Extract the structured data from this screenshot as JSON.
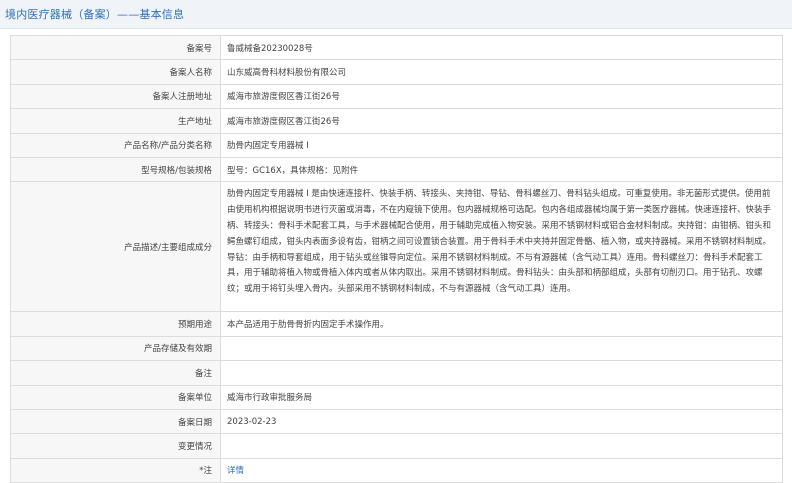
{
  "header": {
    "title": "境内医疗器械（备案）——基本信息"
  },
  "rows": [
    {
      "label": "备案号",
      "value": "鲁威械备20230028号"
    },
    {
      "label": "备案人名称",
      "value": "山东威高骨科材料股份有限公司"
    },
    {
      "label": "备案人注册地址",
      "value": "威海市旅游度假区香江街26号"
    },
    {
      "label": "生产地址",
      "value": "威海市旅游度假区香江街26号"
    },
    {
      "label": "产品名称/产品分类名称",
      "value": "肋骨内固定专用器械 I"
    },
    {
      "label": "型号规格/包装规格",
      "value": "型号：GC16X，具体规格：见附件"
    },
    {
      "label": "产品描述/主要组成成分",
      "value": "肋骨内固定专用器械 I 是由快速连接杆、快装手柄、转接头、夹持钳、导钻、骨科螺丝刀、骨科钻头组成。可重复使用。非无菌形式提供。使用前由使用机构根据说明书进行灭菌或消毒，不在内窥镜下使用。包内器械规格可选配。包内各组成器械均属于第一类医疗器械。快速连接杆、快装手柄、转接头：骨科手术配套工具，与手术器械配合使用，用于辅助完成植入物安装。采用不锈钢材料或铝合金材料制成。夹持钳：由钳柄、钳头和鳄鱼螺钉组成，钳头内表面多设有齿，钳柄之间可设置锁合装置。用于骨科手术中夹持并固定骨骼、植入物，或夹持器械。采用不锈钢材料制成。导钻：由手柄和导套组成，用于钻头或丝锥导向定位。采用不锈钢材料制成。不与有源器械（含气动工具）连用。骨科螺丝刀：骨科手术配套工具，用于辅助将植入物或骨植入体内或者从体内取出。采用不锈钢材料制成。骨科钻头：由头部和柄部组成，头部有切削刃口。用于钻孔、攻螺纹；或用于将钉头埋入骨内。头部采用不锈钢材料制成，不与有源器械（含气动工具）连用。"
    },
    {
      "label": "预期用途",
      "value": "本产品适用于肋骨骨折内固定手术操作用。"
    },
    {
      "label": "产品存储及有效期",
      "value": ""
    },
    {
      "label": "备注",
      "value": ""
    },
    {
      "label": "备案单位",
      "value": "威海市行政审批服务局"
    },
    {
      "label": "备案日期",
      "value": "2023-02-23"
    },
    {
      "label": "变更情况",
      "value": ""
    },
    {
      "label": "*注",
      "value": "详情"
    }
  ]
}
